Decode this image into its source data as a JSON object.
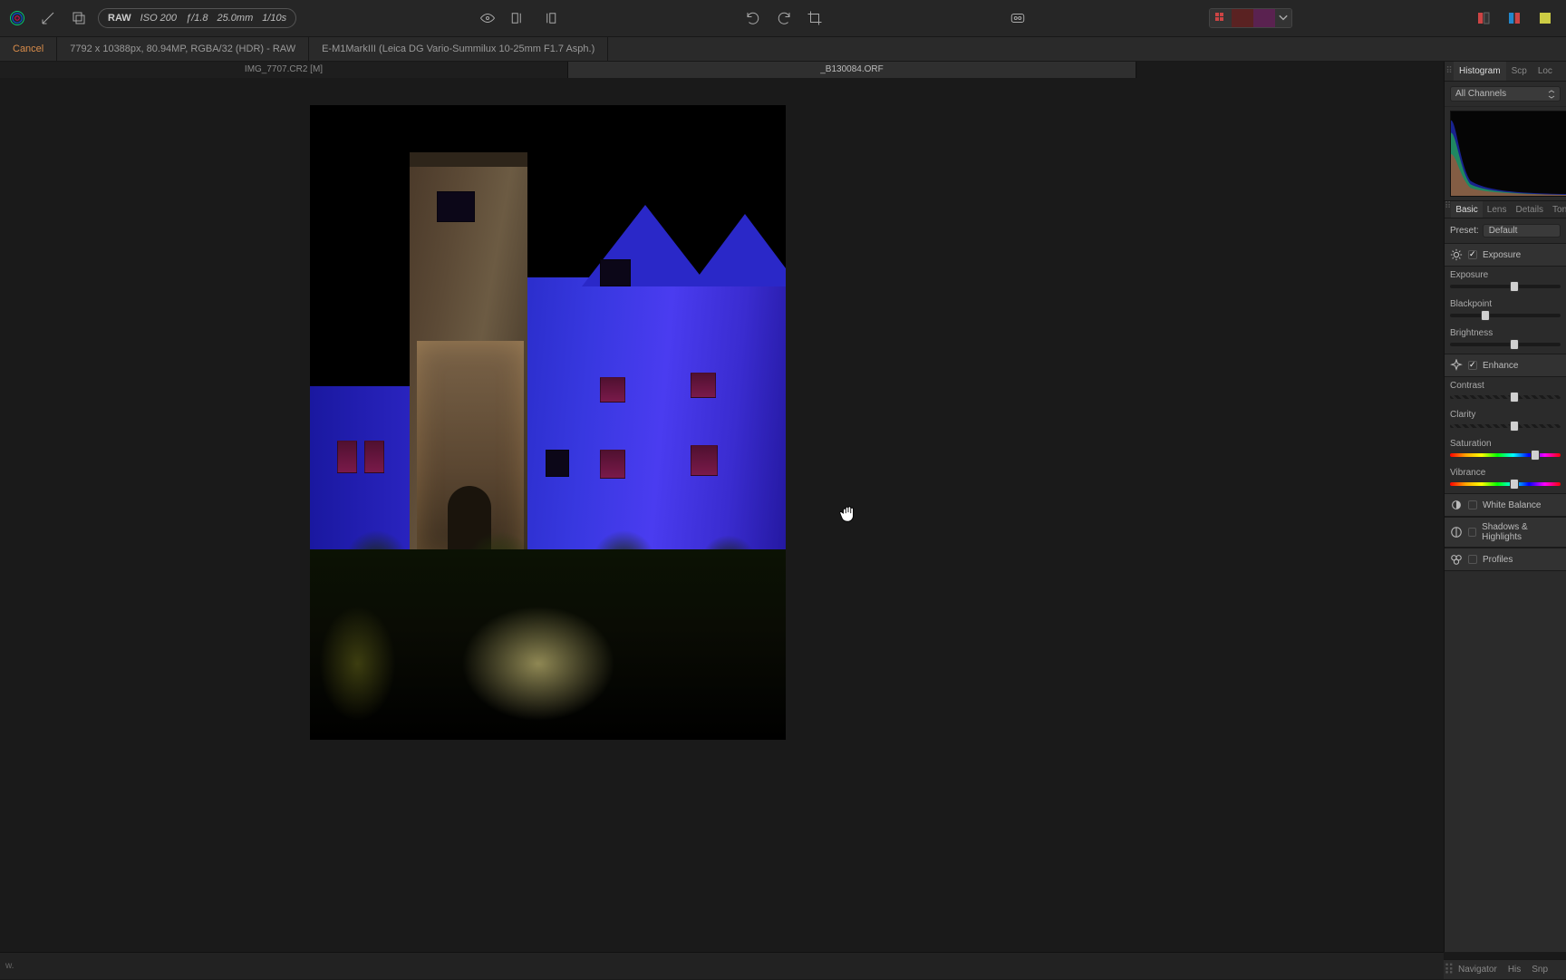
{
  "top": {
    "raw_badge": "RAW",
    "iso": "ISO 200",
    "aperture": "ƒ/1.8",
    "focal": "25.0mm",
    "shutter": "1/10s"
  },
  "info": {
    "cancel": "Cancel",
    "dims": "7792 x 10388px, 80.94MP, RGBA/32 (HDR) - RAW",
    "camera": "E-M1MarkIII (Leica DG Vario-Summilux 10-25mm F1.7 Asph.)"
  },
  "tabs": {
    "left": "IMG_7707.CR2 [M]",
    "right": "_B130084.ORF"
  },
  "sidebar": {
    "top_tabs": {
      "histogram": "Histogram",
      "scp": "Scp",
      "loc": "Loc"
    },
    "channel_label": "All Channels",
    "adj_tabs": {
      "basic": "Basic",
      "lens": "Lens",
      "details": "Details",
      "tones": "Tones"
    },
    "preset_label": "Preset:",
    "preset_value": "Default",
    "sections": {
      "exposure": "Exposure",
      "enhance": "Enhance",
      "wb": "White Balance",
      "sh": "Shadows & Highlights",
      "profiles": "Profiles"
    },
    "sliders": {
      "exposure": "Exposure",
      "blackpoint": "Blackpoint",
      "brightness": "Brightness",
      "contrast": "Contrast",
      "clarity": "Clarity",
      "saturation": "Saturation",
      "vibrance": "Vibrance"
    },
    "bottom_tabs": {
      "navigator": "Navigator",
      "his": "His",
      "snp": "Snp"
    }
  },
  "slider_pos": {
    "exposure": 58,
    "blackpoint": 32,
    "brightness": 58,
    "contrast": 58,
    "clarity": 58,
    "saturation": 77,
    "vibrance": 58
  },
  "status": {
    "text": "w."
  }
}
